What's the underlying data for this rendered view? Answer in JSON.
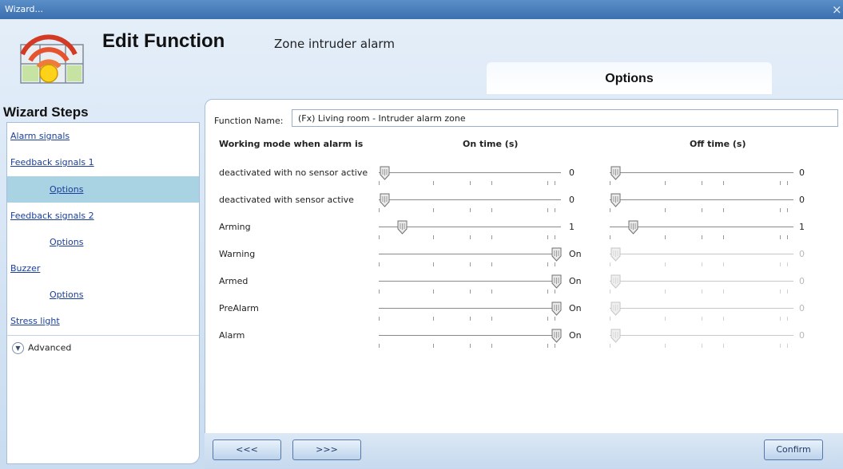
{
  "window": {
    "title": "Wizard...",
    "close_glyph": "×"
  },
  "header": {
    "title": "Edit Function",
    "subtitle": "Zone intruder alarm",
    "logo_icon": "alarm-signal-icon"
  },
  "tab": {
    "label": "Options"
  },
  "sidebar": {
    "title": "Wizard Steps",
    "items": [
      {
        "label": "Alarm signals"
      },
      {
        "label": "Feedback signals 1"
      },
      {
        "label": "Options"
      },
      {
        "label": "Feedback signals 2"
      },
      {
        "label": "Options"
      },
      {
        "label": "Buzzer"
      },
      {
        "label": "Options"
      },
      {
        "label": "Stress light"
      }
    ],
    "advanced": "Advanced"
  },
  "form": {
    "function_name_label": "Function Name:",
    "function_name_value": "(Fx) Living room - Intruder alarm zone",
    "headers": {
      "mode": "Working mode when alarm is",
      "on": "On time (s)",
      "off": "Off time (s)"
    },
    "rows": [
      {
        "label": "deactivated with no sensor active",
        "on_value": "0",
        "on_level": 0.0,
        "off_value": "0",
        "off_level": 0.0,
        "off_disabled": false
      },
      {
        "label": "deactivated with sensor active",
        "on_value": "0",
        "on_level": 0.0,
        "off_value": "0",
        "off_level": 0.0,
        "off_disabled": false
      },
      {
        "label": "Arming",
        "on_value": "1",
        "on_level": 0.1,
        "off_value": "1",
        "off_level": 0.1,
        "off_disabled": false
      },
      {
        "label": "Warning",
        "on_value": "On",
        "on_level": 1.0,
        "off_value": "0",
        "off_level": 0.0,
        "off_disabled": true
      },
      {
        "label": "Armed",
        "on_value": "On",
        "on_level": 1.0,
        "off_value": "0",
        "off_level": 0.0,
        "off_disabled": true
      },
      {
        "label": "PreAlarm",
        "on_value": "On",
        "on_level": 1.0,
        "off_value": "0",
        "off_level": 0.0,
        "off_disabled": true
      },
      {
        "label": "Alarm",
        "on_value": "On",
        "on_level": 1.0,
        "off_value": "0",
        "off_level": 0.0,
        "off_disabled": true
      }
    ]
  },
  "buttons": {
    "back": "<<<",
    "next": ">>>",
    "confirm": "Confirm"
  }
}
